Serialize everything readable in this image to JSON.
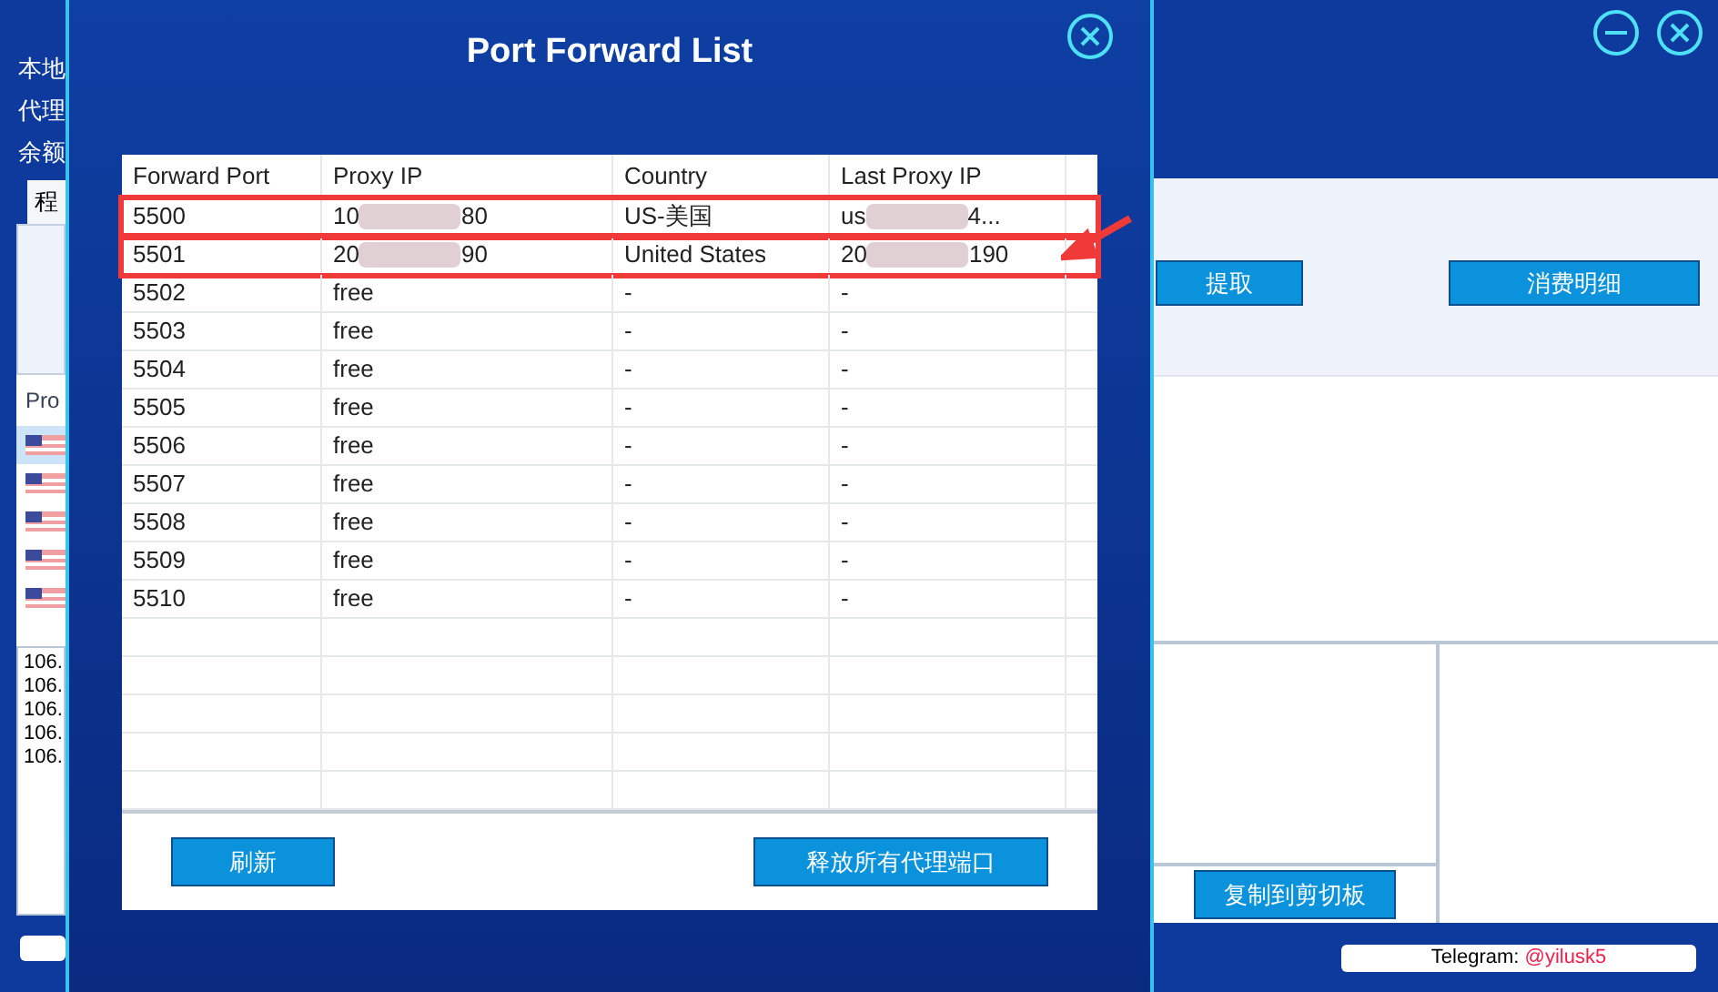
{
  "background_app": {
    "labels": [
      "本地",
      "代理",
      "余额"
    ],
    "tab": {
      "label": "程",
      "selected": true
    },
    "proxy_header": "Pro",
    "flag_rows": [
      {
        "selected": true
      },
      {
        "selected": false
      },
      {
        "selected": false
      },
      {
        "selected": false
      },
      {
        "selected": false
      }
    ],
    "ip_list": [
      "106.",
      "106.",
      "106.",
      "106.",
      "106."
    ],
    "buttons": [
      "提取",
      "消费明细"
    ],
    "copy_button": "复制到剪切板",
    "telegram": {
      "label": "Telegram:",
      "handle": "@yilusk5"
    }
  },
  "dialog": {
    "title": "Port Forward List",
    "table": {
      "columns": [
        "Forward Port",
        "Proxy IP",
        "Country",
        "Last Proxy IP"
      ],
      "rows": [
        {
          "port": "5500",
          "proxy_ip": {
            "start": "10",
            "end": "80",
            "redacted": true
          },
          "country": "US-美国",
          "last_proxy_ip": {
            "start": "us",
            "end": "4...",
            "redacted": true
          },
          "highlighted": true
        },
        {
          "port": "5501",
          "proxy_ip": {
            "start": "20",
            "end": "90",
            "redacted": true
          },
          "country": "United States",
          "last_proxy_ip": {
            "start": "20",
            "end": "190",
            "redacted": true
          },
          "highlighted": true
        },
        {
          "port": "5502",
          "proxy_ip": {
            "start": "free",
            "redacted": false
          },
          "country": "-",
          "last_proxy_ip": {
            "start": "-",
            "redacted": false
          },
          "highlighted": false
        },
        {
          "port": "5503",
          "proxy_ip": {
            "start": "free",
            "redacted": false
          },
          "country": "-",
          "last_proxy_ip": {
            "start": "-",
            "redacted": false
          },
          "highlighted": false
        },
        {
          "port": "5504",
          "proxy_ip": {
            "start": "free",
            "redacted": false
          },
          "country": "-",
          "last_proxy_ip": {
            "start": "-",
            "redacted": false
          },
          "highlighted": false
        },
        {
          "port": "5505",
          "proxy_ip": {
            "start": "free",
            "redacted": false
          },
          "country": "-",
          "last_proxy_ip": {
            "start": "-",
            "redacted": false
          },
          "highlighted": false
        },
        {
          "port": "5506",
          "proxy_ip": {
            "start": "free",
            "redacted": false
          },
          "country": "-",
          "last_proxy_ip": {
            "start": "-",
            "redacted": false
          },
          "highlighted": false
        },
        {
          "port": "5507",
          "proxy_ip": {
            "start": "free",
            "redacted": false
          },
          "country": "-",
          "last_proxy_ip": {
            "start": "-",
            "redacted": false
          },
          "highlighted": false
        },
        {
          "port": "5508",
          "proxy_ip": {
            "start": "free",
            "redacted": false
          },
          "country": "-",
          "last_proxy_ip": {
            "start": "-",
            "redacted": false
          },
          "highlighted": false
        },
        {
          "port": "5509",
          "proxy_ip": {
            "start": "free",
            "redacted": false
          },
          "country": "-",
          "last_proxy_ip": {
            "start": "-",
            "redacted": false
          },
          "highlighted": false
        },
        {
          "port": "5510",
          "proxy_ip": {
            "start": "free",
            "redacted": false
          },
          "country": "-",
          "last_proxy_ip": {
            "start": "-",
            "redacted": false
          },
          "highlighted": false
        }
      ]
    },
    "buttons": [
      "刷新",
      "释放所有代理端口"
    ]
  }
}
